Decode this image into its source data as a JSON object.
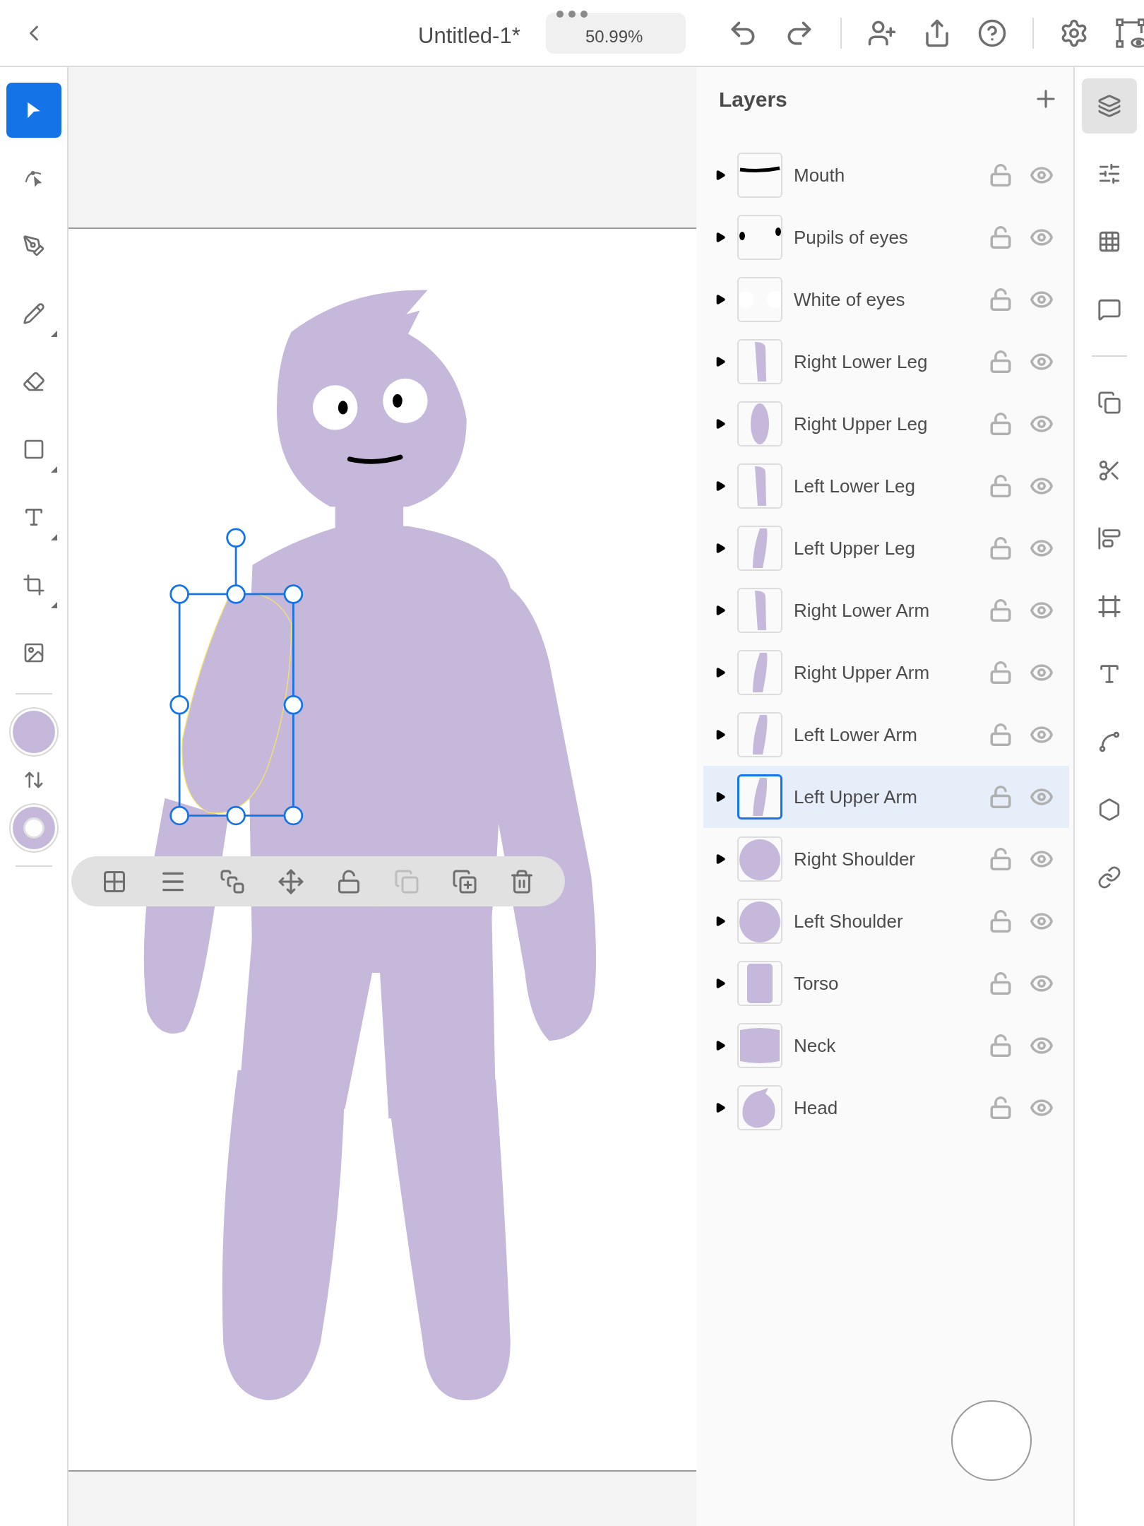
{
  "top_bar": {
    "title": "Untitled-1*",
    "zoom": "50.99%"
  },
  "tools": [
    {
      "kind": "select",
      "selected": true,
      "flyout": false
    },
    {
      "kind": "direct",
      "selected": false,
      "flyout": false
    },
    {
      "kind": "pen",
      "selected": false,
      "flyout": false
    },
    {
      "kind": "pencil",
      "selected": false,
      "flyout": true
    },
    {
      "kind": "eraser",
      "selected": false,
      "flyout": false
    },
    {
      "kind": "rectangle",
      "selected": false,
      "flyout": true
    },
    {
      "kind": "type",
      "selected": false,
      "flyout": true
    },
    {
      "kind": "crop",
      "selected": false,
      "flyout": true
    },
    {
      "kind": "image",
      "selected": false,
      "flyout": false
    }
  ],
  "layers_panel": {
    "title": "Layers",
    "layers": [
      {
        "name": "Mouth",
        "kind": "stroke",
        "selected": false,
        "expanded": false,
        "locked": false,
        "visible": true
      },
      {
        "name": "Pupils of eyes",
        "kind": "dots",
        "selected": false,
        "expanded": false,
        "locked": false,
        "visible": true
      },
      {
        "name": "White of eyes",
        "kind": "white-dots",
        "selected": false,
        "expanded": false,
        "locked": false,
        "visible": true
      },
      {
        "name": "Right Lower Leg",
        "kind": "limb",
        "selected": false,
        "expanded": false,
        "locked": false,
        "visible": true
      },
      {
        "name": "Right Upper Leg",
        "kind": "wide-limb",
        "selected": false,
        "expanded": false,
        "locked": false,
        "visible": true
      },
      {
        "name": "Left Lower Leg",
        "kind": "limb",
        "selected": false,
        "expanded": false,
        "locked": false,
        "visible": true
      },
      {
        "name": "Left Upper Leg",
        "kind": "tilted-limb",
        "selected": false,
        "expanded": false,
        "locked": false,
        "visible": true
      },
      {
        "name": "Right Lower Arm",
        "kind": "limb",
        "selected": false,
        "expanded": false,
        "locked": false,
        "visible": true
      },
      {
        "name": "Right Upper Arm",
        "kind": "tilted-limb",
        "selected": false,
        "expanded": false,
        "locked": false,
        "visible": true
      },
      {
        "name": "Left Lower Arm",
        "kind": "tilted-limb",
        "selected": false,
        "expanded": false,
        "locked": false,
        "visible": true
      },
      {
        "name": "Left Upper Arm",
        "kind": "tilted-limb",
        "selected": true,
        "expanded": false,
        "locked": false,
        "visible": true
      },
      {
        "name": "Right Shoulder",
        "kind": "circle",
        "selected": false,
        "expanded": false,
        "locked": false,
        "visible": true
      },
      {
        "name": "Left Shoulder",
        "kind": "circle",
        "selected": false,
        "expanded": false,
        "locked": false,
        "visible": true
      },
      {
        "name": "Torso",
        "kind": "rect",
        "selected": false,
        "expanded": false,
        "locked": false,
        "visible": true
      },
      {
        "name": "Neck",
        "kind": "wide",
        "selected": false,
        "expanded": false,
        "locked": false,
        "visible": true
      },
      {
        "name": "Head",
        "kind": "head",
        "selected": false,
        "expanded": false,
        "locked": false,
        "visible": true
      }
    ]
  },
  "panels": [
    {
      "kind": "layers",
      "selected": true
    },
    {
      "kind": "properties",
      "selected": false
    },
    {
      "kind": "grid",
      "selected": false
    },
    {
      "kind": "comments",
      "selected": false
    },
    {
      "kind": "divider"
    },
    {
      "kind": "arrange",
      "selected": false
    },
    {
      "kind": "cut",
      "selected": false
    },
    {
      "kind": "align",
      "selected": false
    },
    {
      "kind": "transform",
      "selected": false
    },
    {
      "kind": "type",
      "selected": false
    },
    {
      "kind": "path",
      "selected": false
    },
    {
      "kind": "repeat",
      "selected": false
    },
    {
      "kind": "link",
      "selected": false
    }
  ]
}
